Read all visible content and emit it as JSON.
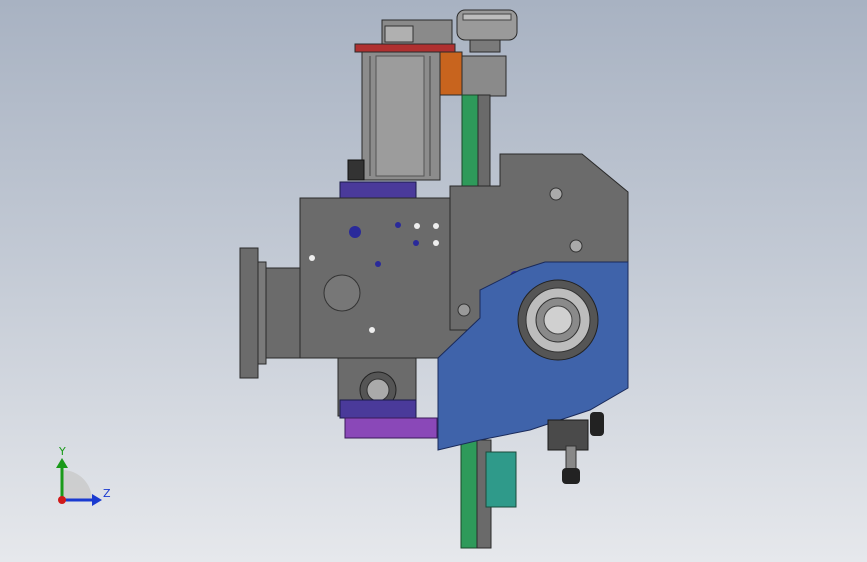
{
  "viewport": {
    "background_top": "#a8b2c2",
    "background_bottom": "#e6e8ec"
  },
  "model": {
    "colors": {
      "housing": "#6b6b6b",
      "housing_edge": "#2a2a2a",
      "blue_guard": "#3f63aa",
      "green_rail": "#2e9a5a",
      "orange_bracket": "#c8641e",
      "red_plate": "#b03030",
      "purple_block": "#4a3a9a",
      "violet_arm": "#8a48b8",
      "motor": "#8c8c8c",
      "teal_block": "#2f9a8a"
    }
  },
  "triad": {
    "y_label": "Y",
    "z_label": "Z",
    "y_color": "#1a9a1a",
    "z_color": "#1a3ad0",
    "origin_color": "#d01a1a"
  }
}
